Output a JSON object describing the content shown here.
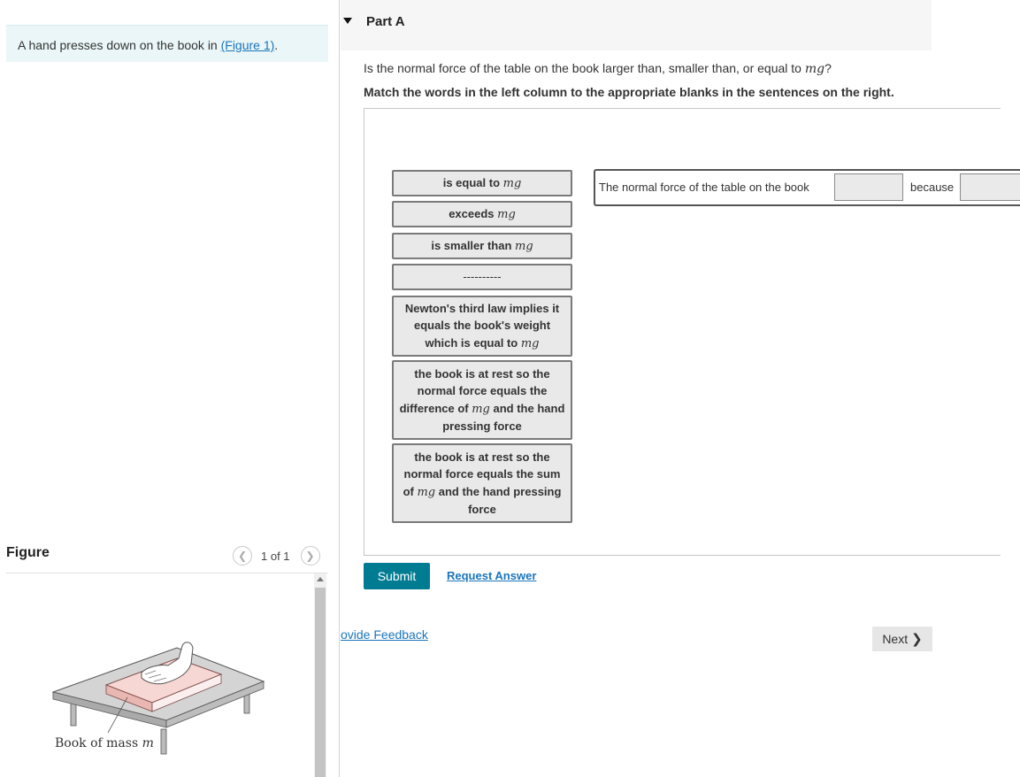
{
  "intro": {
    "text_prefix": "A hand presses down on the book in ",
    "link_label": "(Figure 1)",
    "text_suffix": "."
  },
  "figure": {
    "title": "Figure",
    "pager": "1 of 1",
    "caption_prefix": "Book of mass ",
    "caption_var": "m"
  },
  "part": {
    "title": "Part A",
    "question_prefix": "Is the normal force of the table on the book larger than, smaller than, or equal to ",
    "question_var": "mg",
    "question_suffix": "?",
    "instructions": "Match the words in the left column to the appropriate blanks in the sentences on the right."
  },
  "tiles": [
    {
      "pre": "is equal to ",
      "var": "mg",
      "post": ""
    },
    {
      "pre": "exceeds ",
      "var": "mg",
      "post": ""
    },
    {
      "pre": "is smaller than ",
      "var": "mg",
      "post": ""
    },
    {
      "pre": "----------",
      "var": "",
      "post": ""
    },
    {
      "pre": "Newton's third law implies it equals the book's weight which is equal to ",
      "var": "mg",
      "post": ""
    },
    {
      "pre": "the book is at rest so the normal force equals the difference of ",
      "var": "mg",
      "post": " and the hand pressing force"
    },
    {
      "pre": "the book is at rest so the normal force equals the sum of ",
      "var": "mg",
      "post": " and the hand pressing force"
    }
  ],
  "sentence": {
    "part1": "The normal force of the table on the book",
    "part2": "because"
  },
  "actions": {
    "submit": "Submit",
    "request_answer": "Request Answer",
    "feedback": "ovide Feedback",
    "next": "Next"
  },
  "colors": {
    "accent": "#007c92",
    "link": "#1b75bb",
    "intro_bg": "#eaf6f7"
  }
}
